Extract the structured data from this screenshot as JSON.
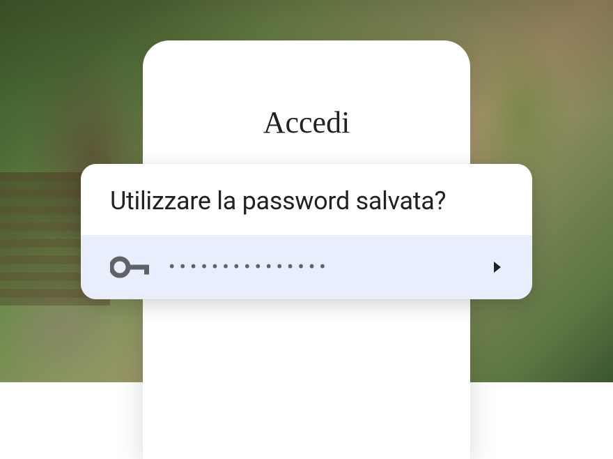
{
  "page": {
    "title": "Accedi"
  },
  "dialog": {
    "title": "Utilizzare la password salvata?",
    "password_mask": "•••••••••••••••"
  },
  "icons": {
    "key": "key-icon",
    "chevron": "chevron-right-icon"
  },
  "colors": {
    "card_bg": "#ffffff",
    "row_bg": "#e8eefb",
    "text_primary": "#202124",
    "text_secondary": "#5f6368"
  }
}
